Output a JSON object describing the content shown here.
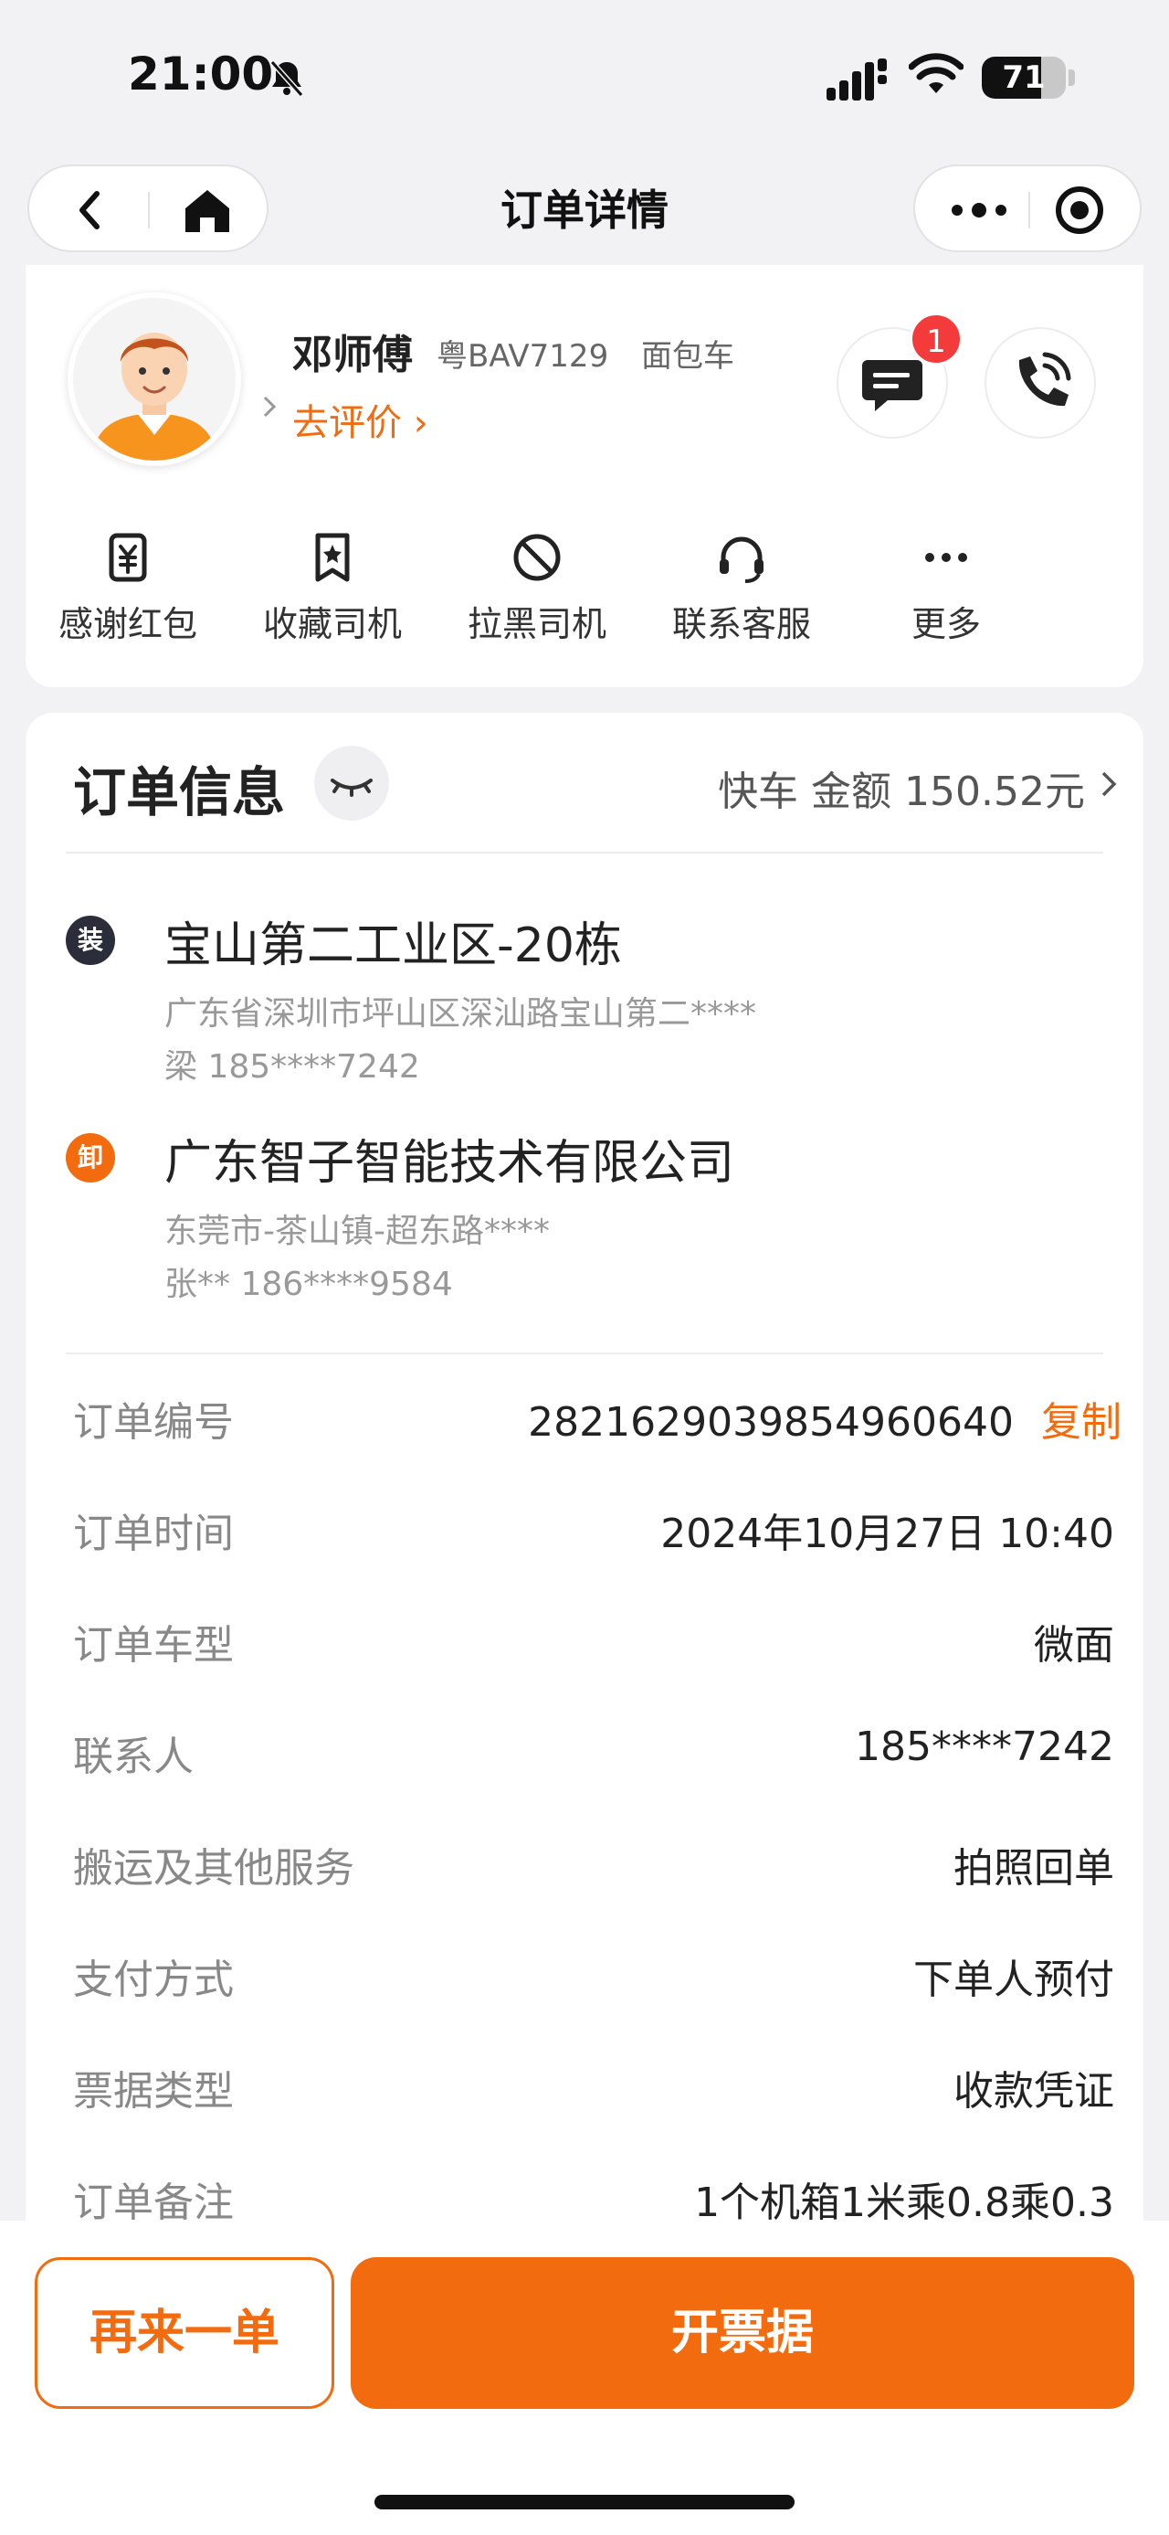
{
  "status_bar": {
    "time": "21:00",
    "battery": "71",
    "battery_level": 0.71
  },
  "nav": {
    "title": "订单详情"
  },
  "driver": {
    "name": "邓师傅",
    "plate": "粤BAV7129",
    "vehicle": "面包车",
    "rate_label": "去评价 ›",
    "chat_badge": "1",
    "actions": [
      {
        "label": "感谢红包",
        "icon": "yuan-icon"
      },
      {
        "label": "收藏司机",
        "icon": "bookmark-star-icon"
      },
      {
        "label": "拉黑司机",
        "icon": "ban-icon"
      },
      {
        "label": "联系客服",
        "icon": "headset-icon"
      },
      {
        "label": "更多",
        "icon": "more-dots-icon"
      }
    ]
  },
  "order": {
    "title": "订单信息",
    "meta": "快车  金额 150.52元",
    "load": {
      "badge": "装",
      "name": "宝山第二工业区-20栋",
      "detail": "广东省深圳市坪山区深汕路宝山第二****",
      "contact": "梁 185****7242"
    },
    "unload": {
      "badge": "卸",
      "name": "广东智子智能技术有限公司",
      "detail": "东莞市-茶山镇-超东路****",
      "contact": "张** 186****9584"
    },
    "rows": [
      {
        "label": "订单编号",
        "value": "2821629039854960640",
        "action": "复制"
      },
      {
        "label": "订单时间",
        "value": "2024年10月27日 10:40"
      },
      {
        "label": "订单车型",
        "value": "微面"
      },
      {
        "label": "联系人",
        "value": "185****7242"
      },
      {
        "label": "搬运及其他服务",
        "value": "拍照回单"
      },
      {
        "label": "支付方式",
        "value": "下单人预付"
      },
      {
        "label": "票据类型",
        "value": "收款凭证"
      },
      {
        "label": "订单备注",
        "value": "1个机箱1米乘0.8乘0.3"
      }
    ]
  },
  "bottom": {
    "again_label": "再来一单",
    "invoice_label": "开票据"
  },
  "colors": {
    "accent": "#f26b0f",
    "badge_red": "#f43b3b",
    "load_badge": "#2b2d3a"
  }
}
